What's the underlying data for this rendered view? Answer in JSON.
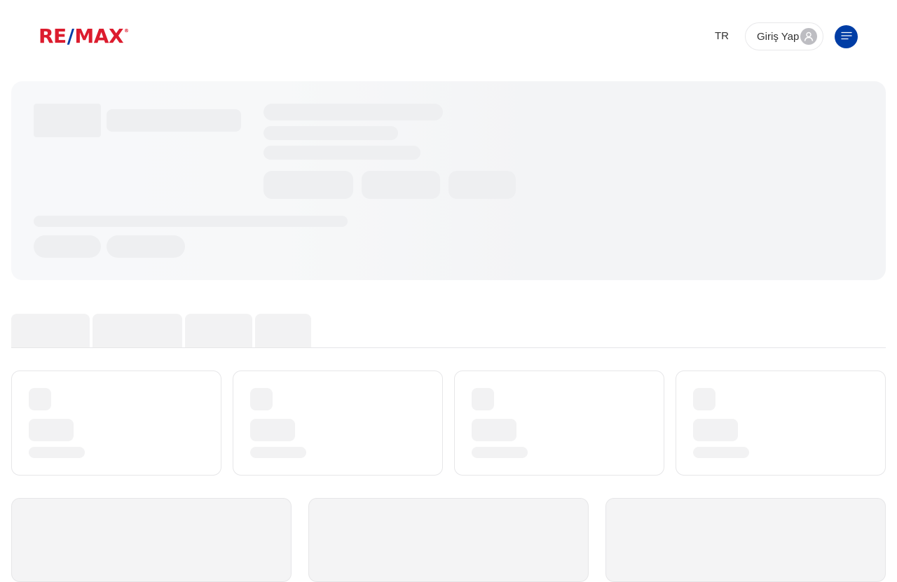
{
  "header": {
    "logo": {
      "part1": "RE",
      "slash": "/",
      "part2": "MAX",
      "reg": "®"
    },
    "language": "TR",
    "login_label": "Giriş Yap",
    "icons": {
      "avatar": "user-icon",
      "menu": "hamburger-menu-icon"
    }
  },
  "colors": {
    "brand_red": "#dc1c2e",
    "brand_blue": "#003da5",
    "skeleton": "#f2f2f3"
  },
  "loading_state": "skeleton"
}
